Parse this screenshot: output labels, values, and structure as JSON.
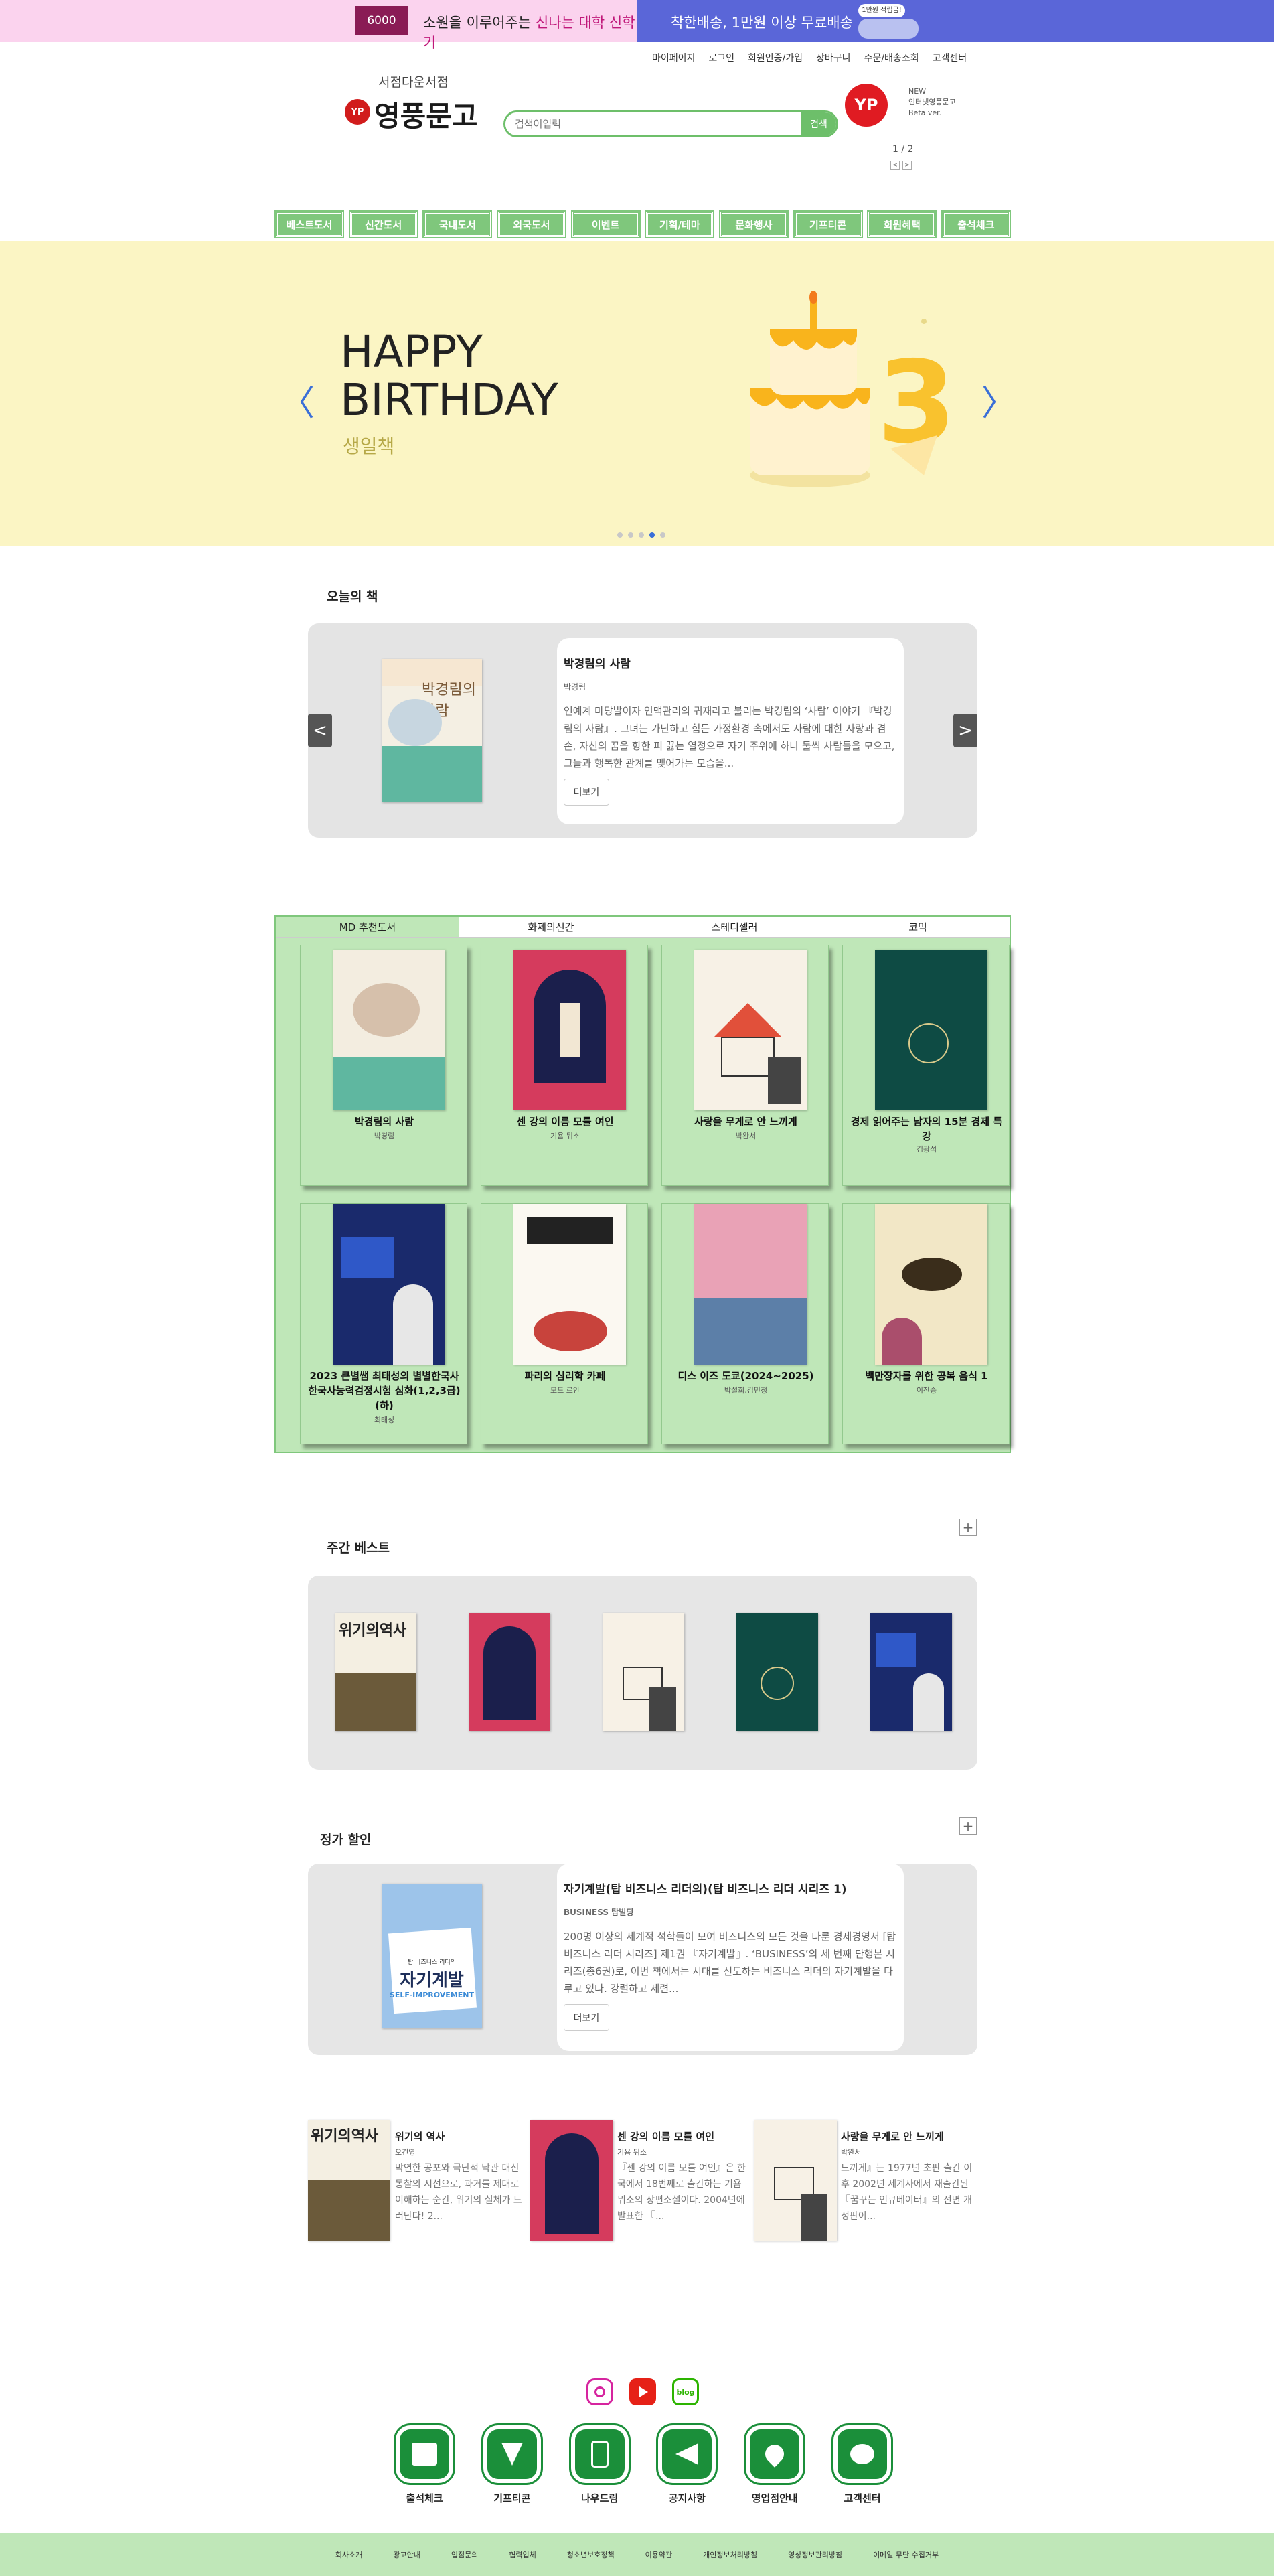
{
  "top_banner": {
    "badge": "6000",
    "left_text_a": "소원을 이루어주는 ",
    "left_text_b": "신나는 대학 신학기",
    "right_text": "착한배송, 1만원 이상 무료배송",
    "pill": "1만원 적립금!"
  },
  "util_nav": [
    "마이페이지",
    "로그인",
    "회원인증/가입",
    "장바구니",
    "주문/배송조회",
    "고객센터"
  ],
  "logo": {
    "sub": "서점다운서점",
    "main": "영풍문고",
    "mark": "YP"
  },
  "search": {
    "placeholder": "검색어입력",
    "button": "검색"
  },
  "yp_ad": {
    "mark": "YP",
    "line1": "NEW",
    "line2": "인터넷영풍문고",
    "line3": "Beta ver.",
    "page": "1 / 2",
    "prev": "<",
    "next": ">"
  },
  "category_nav": [
    "베스트도서",
    "신간도서",
    "국내도서",
    "외국도서",
    "이벤트",
    "기획/테마",
    "문화행사",
    "기프티콘",
    "회원혜택",
    "출석체크"
  ],
  "hero": {
    "title_line1": "HAPPY",
    "title_line2": "BIRTHDAY",
    "subtitle": "생일책",
    "prev": "〈",
    "next": "〉",
    "cake_number": "3",
    "dots": 5,
    "active_dot": 3
  },
  "todays_book": {
    "section_title": "오늘의 책",
    "title": "박경림의 사람",
    "author": "박경림",
    "description": "연예계 마당발이자 인맥관리의 귀재라고 불리는 박경림의 ‘사람’ 이야기 『박경림의 사람』. 그녀는 가난하고 힘든 가정환경 속에서도 사람에 대한 사랑과 겸손, 자신의 꿈을 향한 피 끓는 열정으로 자기 주위에 하나 둘씩 사람들을 모으고, 그들과 행복한 관계를 맺어가는 모습을...",
    "more": "더보기",
    "prev": "<",
    "next": ">",
    "cover_title": "박경림의 사람"
  },
  "tabs": [
    "MD 추천도서",
    "화제의신간",
    "스테디셀러",
    "코믹"
  ],
  "md_books": [
    {
      "title": "박경림의 사람",
      "author": "박경림"
    },
    {
      "title": "센 강의 이름 모를 여인",
      "author": "기욤 뮈소"
    },
    {
      "title": "사랑을 무게로 안 느끼게",
      "author": "박완서"
    },
    {
      "title": "경제 읽어주는 남자의 15분 경제 특강",
      "author": "김광석"
    },
    {
      "title": "2023 큰별쌤 최태성의 별별한국사 한국사능력검정시험 심화(1,2,3급)(하)",
      "author": "최태성"
    },
    {
      "title": "파리의 심리학 카페",
      "author": "모드 르안"
    },
    {
      "title": "디스 이즈 도쿄(2024~2025)",
      "author": "박설희,김민정"
    },
    {
      "title": "백만장자를 위한 공복 음식 1",
      "author": "이찬승"
    }
  ],
  "weekly_best": {
    "section_title": "주간 베스트",
    "plus": "+",
    "covers": [
      "위기의역사",
      "센 강의 이름 모를 여인",
      "사랑을 무게로 안 느끼게",
      "15분 경제 특강",
      "한국사"
    ]
  },
  "discount": {
    "section_title": "정가 할인",
    "plus": "+",
    "title": "자기계발(탑 비즈니스 리더의)(탑 비즈니스 리더 시리즈 1)",
    "author": "BUSINESS 탑빌딩",
    "description": "200명 이상의 세계적 석학들이 모여 비즈니스의 모든 것을 다룬 경제경영서 [탑 비즈니스 리더 시리즈] 제1권 『자기계발』. ‘BUSINESS’의 세 번째 단행본 시리즈(총6권)로, 이번 책에서는 시대를 선도하는 비즈니스 리더의 자기계발을 다루고 있다. 강렬하고 세련...",
    "more": "더보기",
    "cover_sub": "탑 비즈니스 리더의",
    "cover_title": "자기계발",
    "cover_en": "SELF-IMPROVEMENT"
  },
  "bottom_list": [
    {
      "title": "위기의 역사",
      "author": "오건영",
      "description": "막연한 공포와 극단적 낙관 대신 통찰의 시선으로, 과거를 제대로 이해하는 순간, 위기의 실체가 드러난다! 2...",
      "cover": "위기의역사"
    },
    {
      "title": "센 강의 이름 모를 여인",
      "author": "기욤 뮈소",
      "description": "『센 강의 이름 모를 여인』은 한국에서 18번째로 출간하는 기욤 뮈소의 장편소설이다. 2004년에 발표한 『...",
      "cover": ""
    },
    {
      "title": "사랑을 무게로 안 느끼게",
      "author": "박완서",
      "description": "느끼게』는 1977년 초판 출간 이후 2002년 세계사에서 재출간된 『꿈꾸는 인큐베이터』의 전면 개정판이...",
      "cover": ""
    }
  ],
  "social": [
    {
      "icon": "instagram-icon",
      "color": "#d6249f"
    },
    {
      "icon": "youtube-icon",
      "color": "#e62117"
    },
    {
      "icon": "blog-icon",
      "color": "#2db400",
      "label": "blog"
    }
  ],
  "quick_links": [
    "출석체크",
    "기프티콘",
    "나우드림",
    "공지사항",
    "영업점안내",
    "고객센터"
  ],
  "footer_links": [
    "회사소개",
    "광고안내",
    "입점문의",
    "협력업체",
    "청소년보호정책",
    "이용약관",
    "개인정보처리방침",
    "영상정보관리방침",
    "이메일 무단 수집거부"
  ],
  "colors": {
    "accent_green": "#7fc77c",
    "light_green": "#bfe7b8",
    "banner_pink": "#fbd3ee",
    "banner_blue": "#5a66d8",
    "hero_yellow": "#fbf5c4",
    "brand_red": "#d11c1c"
  }
}
